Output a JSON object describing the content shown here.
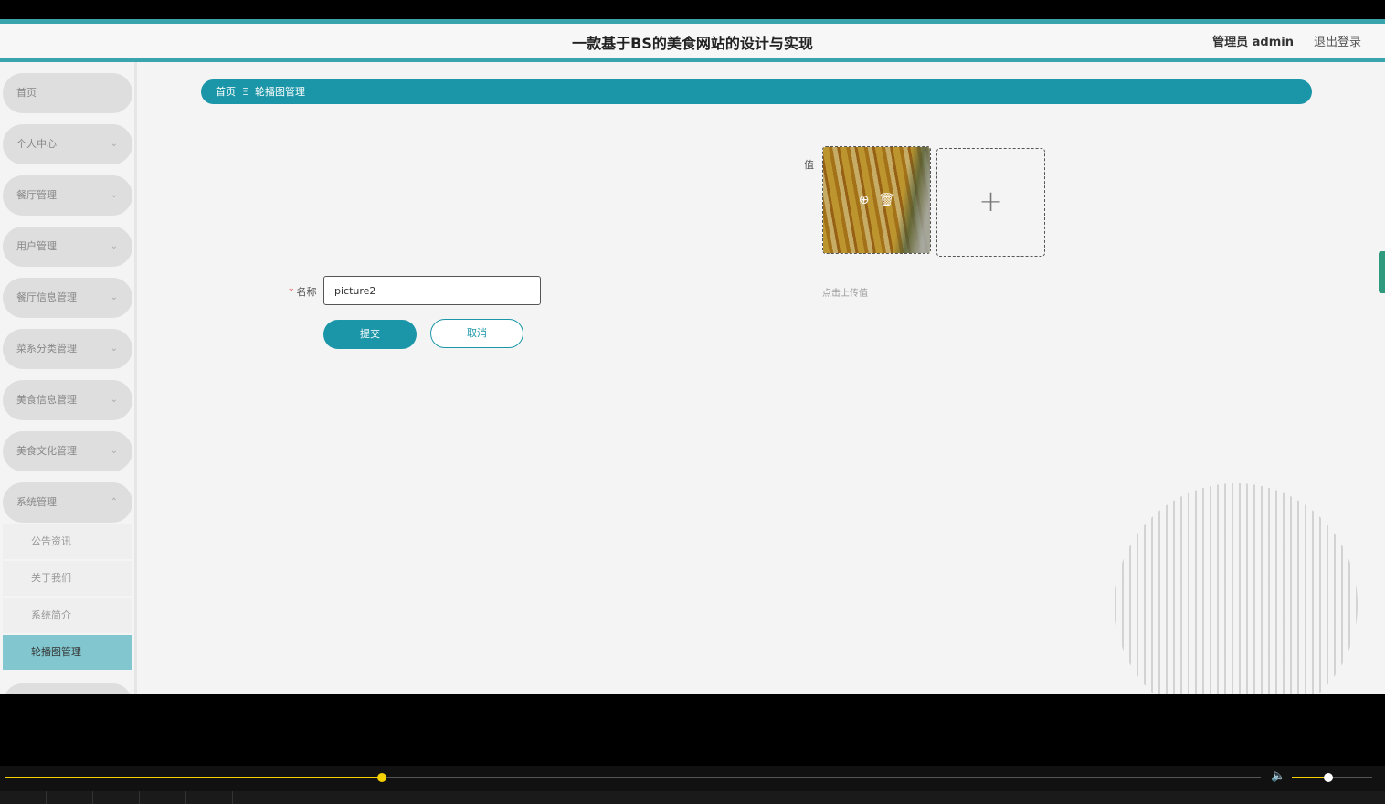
{
  "header": {
    "title": "一款基于BS的美食网站的设计与实现",
    "admin_label": "管理员 admin",
    "logout": "退出登录"
  },
  "sidebar": {
    "items": [
      {
        "label": "首页",
        "chevron": ""
      },
      {
        "label": "个人中心",
        "chevron": "⌄"
      },
      {
        "label": "餐厅管理",
        "chevron": "⌄"
      },
      {
        "label": "用户管理",
        "chevron": "⌄"
      },
      {
        "label": "餐厅信息管理",
        "chevron": "⌄"
      },
      {
        "label": "菜系分类管理",
        "chevron": "⌄"
      },
      {
        "label": "美食信息管理",
        "chevron": "⌄"
      },
      {
        "label": "美食文化管理",
        "chevron": "⌄"
      },
      {
        "label": "系统管理",
        "chevron": "⌃"
      }
    ],
    "sub_items": [
      {
        "label": "公告资讯"
      },
      {
        "label": "关于我们"
      },
      {
        "label": "系统简介"
      },
      {
        "label": "轮播图管理",
        "active": true
      }
    ]
  },
  "breadcrumb": {
    "home": "首页",
    "separator": "Ξ",
    "current": "轮播图管理"
  },
  "form": {
    "value_label": "值",
    "name_required_mark": "*",
    "name_label": "名称",
    "name_value": "picture2",
    "submit_label": "提交",
    "cancel_label": "取消",
    "upload_tip": "点击上传值",
    "upload_plus": "+",
    "preview_icon": "⊕",
    "delete_icon": "🗑"
  },
  "player": {
    "progress": 0.3,
    "volume": 0.45,
    "volume_icon": "🔈"
  },
  "colors": {
    "accent": "#1b96a8",
    "header_border": "#3aa4ad",
    "active_sub": "#82c7cf",
    "player_accent": "#f5d100"
  }
}
